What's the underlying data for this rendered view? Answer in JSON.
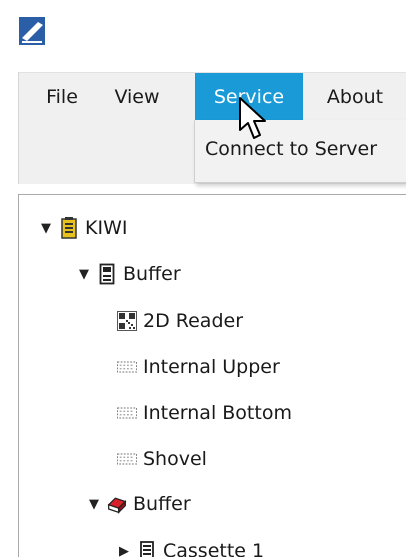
{
  "menu": {
    "file": "File",
    "view": "View",
    "service": "Service",
    "about": "About"
  },
  "dropdown": {
    "connect": "Connect to Server"
  },
  "tree": {
    "kiwi": "KIWI",
    "buffer1": "Buffer",
    "reader2d": "2D Reader",
    "internal_upper": "Internal Upper",
    "internal_bottom": "Internal Bottom",
    "shovel": "Shovel",
    "buffer2": "Buffer",
    "cassette1": "Cassette 1"
  },
  "colors": {
    "menu_active": "#1a9ad6",
    "app_icon": "#2a5fa8"
  },
  "icons": {
    "app": "app-logo-icon",
    "cursor": "mouse-pointer-icon"
  }
}
